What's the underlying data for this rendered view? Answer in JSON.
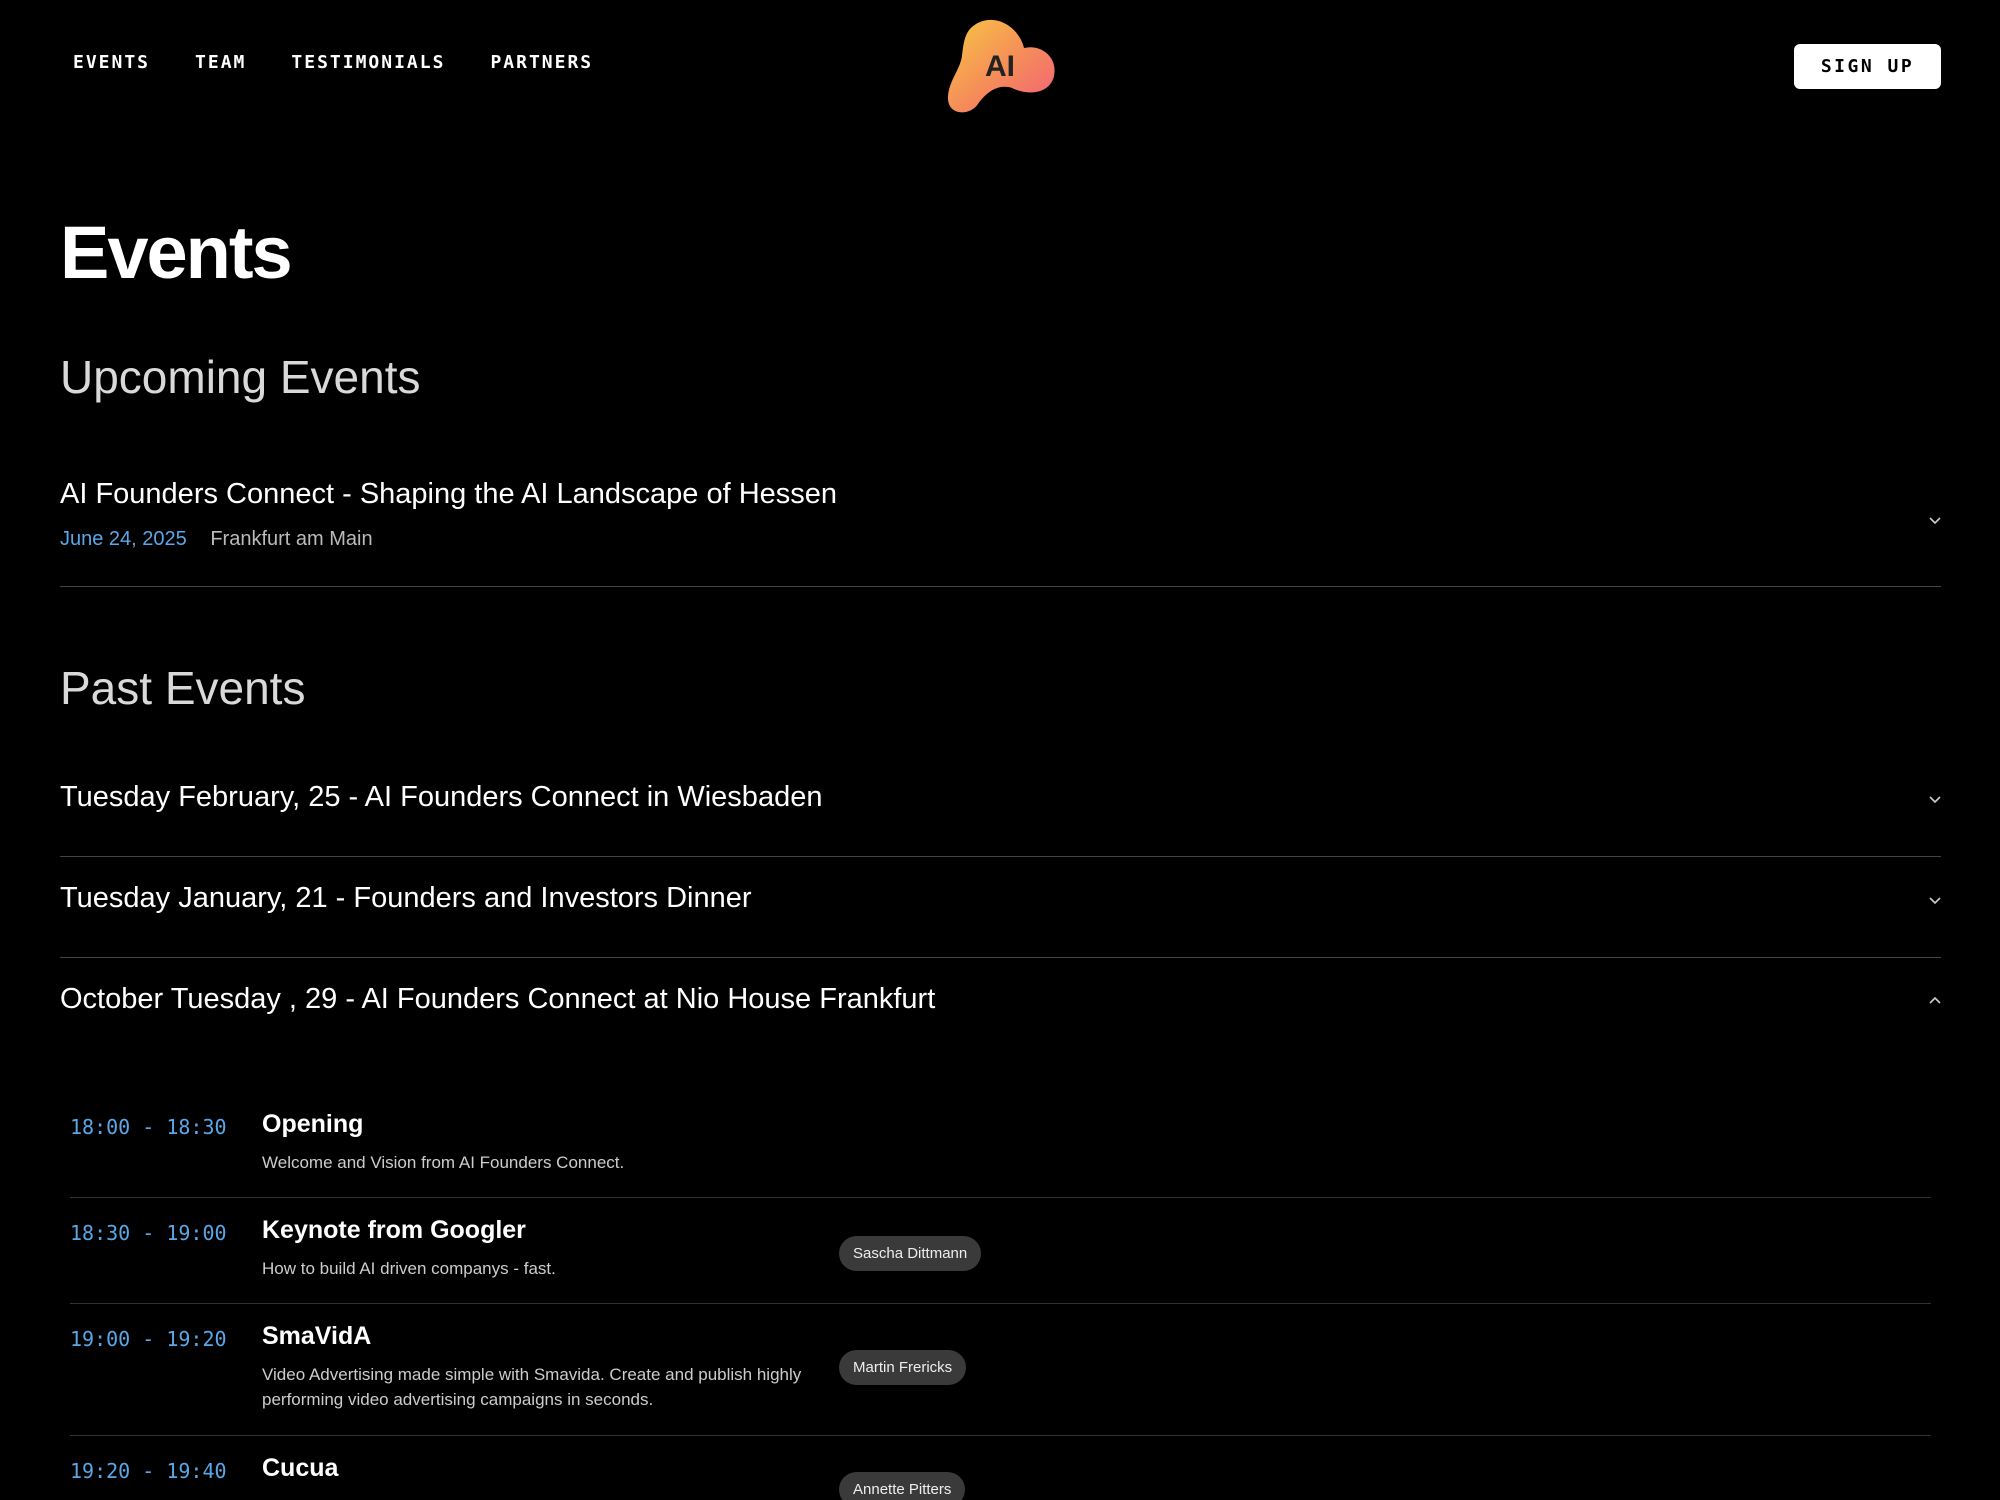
{
  "nav": {
    "items": [
      {
        "label": "EVENTS"
      },
      {
        "label": "TEAM"
      },
      {
        "label": "TESTIMONIALS"
      },
      {
        "label": "PARTNERS"
      }
    ],
    "signup_label": "SIGN UP"
  },
  "logo": {
    "text": "AI",
    "colors": [
      "#f7c744",
      "#f58a5a",
      "#f2607a"
    ]
  },
  "page_title": "Events",
  "upcoming": {
    "heading": "Upcoming Events",
    "event": {
      "title": "AI Founders Connect - Shaping the AI Landscape of Hessen",
      "date": "June 24, 2025",
      "location": "Frankfurt am Main",
      "expanded": false
    }
  },
  "past": {
    "heading": "Past Events",
    "events": [
      {
        "title": "Tuesday February, 25 - AI Founders Connect in Wiesbaden",
        "expanded": false
      },
      {
        "title": "Tuesday January, 21 - Founders and Investors Dinner",
        "expanded": false
      },
      {
        "title": "October Tuesday , 29 - AI Founders Connect at Nio House Frankfurt",
        "expanded": true
      }
    ]
  },
  "agenda": [
    {
      "time": "18:00 - 18:30",
      "title": "Opening",
      "description": "Welcome and Vision from AI Founders Connect.",
      "speaker": ""
    },
    {
      "time": "18:30 - 19:00",
      "title": "Keynote from Googler",
      "description": "How to build AI driven companys - fast.",
      "speaker": "Sascha Dittmann"
    },
    {
      "time": "19:00 - 19:20",
      "title": "SmaVidA",
      "description": "Video Advertising made simple with Smavida. Create and publish highly performing video advertising campaigns in seconds.",
      "speaker": "Martin Frericks"
    },
    {
      "time": "19:20 - 19:40",
      "title": "Cucua",
      "description": "",
      "speaker": "Annette Pitters"
    }
  ],
  "colors": {
    "accent": "#5aa7e8",
    "background": "#000000",
    "divider": "#444444",
    "chip": "#3a3a3a"
  }
}
